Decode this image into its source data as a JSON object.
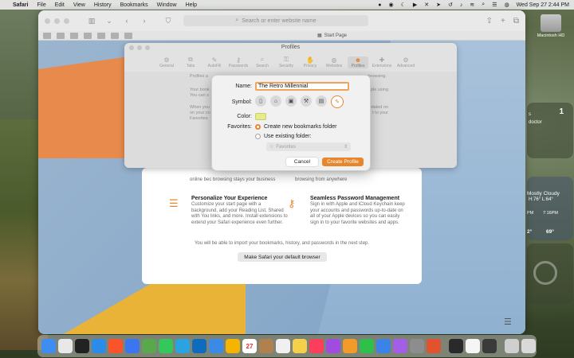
{
  "menubar": {
    "app": "Safari",
    "menus": [
      "File",
      "Edit",
      "View",
      "History",
      "Bookmarks",
      "Window",
      "Help"
    ],
    "clock": "Wed Sep 27  2:44 PM"
  },
  "safari": {
    "address_placeholder": "Search or enter website name",
    "tab_title": "Start Page"
  },
  "profiles_window": {
    "title": "Profiles",
    "tabs": [
      "General",
      "Tabs",
      "AutoFill",
      "Passwords",
      "Search",
      "Security",
      "Privacy",
      "Websites",
      "Profiles",
      "Extensions",
      "Advanced"
    ],
    "left_lines": [
      "Profiles a",
      "Your book",
      "You can s",
      "When you",
      "on your co",
      "Favorites"
    ],
    "right_lines": [
      "browsing.",
      "",
      "pple using",
      "",
      "pdated on",
      "t to your",
      "c"
    ]
  },
  "dialog": {
    "name_label": "Name:",
    "name_value": "The Retro Millennial",
    "symbol_label": "Symbol:",
    "symbols": [
      "id-card-icon",
      "graduation-cap-icon",
      "briefcase-icon",
      "hammer-icon",
      "building-icon",
      "pencil-icon"
    ],
    "color_label": "Color:",
    "color_value": "#e6ec8a",
    "favorites_label": "Favorites:",
    "option_new": "Create new bookmarks folder",
    "option_existing": "Use existing folder:",
    "folder_placeholder": "Favorites",
    "cancel": "Cancel",
    "create": "Create Profile"
  },
  "welcome": {
    "top_left": "online bec  browsing stays your business",
    "top_right": "browsing from anywhere",
    "features": [
      {
        "title": "Personalize Your Experience",
        "body": "Customize your start page with a background, add your Reading List, Shared with You links, and more. Install extensions to extend your Safari experience even further."
      },
      {
        "title": "Seamless Password Management",
        "body": "Sign in with Apple and iCloud Keychain keep your accounts and passwords up-to-date on all of your Apple devices so you can easily sign in to your favorite websites and apps."
      }
    ],
    "import_note": "You will be able to import your bookmarks, history, and passwords in the next step.",
    "default_button": "Make Safari your default browser"
  },
  "desktop": {
    "hdd_label": "Macintosh HD",
    "reminders": {
      "count": "1",
      "text": "s\ndoctor"
    },
    "weather": {
      "condition": "Mostly Cloudy",
      "hilo": "H:76° L:64°",
      "time1": "PM",
      "time2": "7:16PM",
      "temp1": "2°",
      "temp2": "69°"
    }
  },
  "dock_icons": [
    {
      "name": "finder-icon",
      "color": "#3d8ef0"
    },
    {
      "name": "launchpad-icon",
      "color": "#e8e8e8"
    },
    {
      "name": "terminal-icon",
      "color": "#222222"
    },
    {
      "name": "safari-icon",
      "color": "#2a8be8"
    },
    {
      "name": "brave-icon",
      "color": "#fb542b"
    },
    {
      "name": "signal-icon",
      "color": "#3a76f0"
    },
    {
      "name": "maps-icon",
      "color": "#59a84b"
    },
    {
      "name": "messages-icon",
      "color": "#34c759"
    },
    {
      "name": "telegram-icon",
      "color": "#2aa3e0"
    },
    {
      "name": "outlook-icon",
      "color": "#0f6cbd"
    },
    {
      "name": "mail-icon",
      "color": "#3b8be6"
    },
    {
      "name": "photos-icon",
      "color": "#f4b400"
    },
    {
      "name": "calendar-icon",
      "color": "#ffffff"
    },
    {
      "name": "contacts-icon",
      "color": "#b0814f"
    },
    {
      "name": "reminders-icon",
      "color": "#f0f0f0"
    },
    {
      "name": "notes-icon",
      "color": "#f5d04a"
    },
    {
      "name": "music-icon",
      "color": "#fa3e5c"
    },
    {
      "name": "podcasts-icon",
      "color": "#a24be0"
    },
    {
      "name": "pages-icon",
      "color": "#f29b2a"
    },
    {
      "name": "numbers-icon",
      "color": "#2fbf4b"
    },
    {
      "name": "keynote-icon",
      "color": "#3b83e6"
    },
    {
      "name": "flower-app-icon",
      "color": "#a35ee8"
    },
    {
      "name": "settings-icon",
      "color": "#8d8d8d"
    },
    {
      "name": "gauge-icon",
      "color": "#e2522f"
    },
    {
      "name": "activity-monitor-icon",
      "color": "#2a2a2a"
    },
    {
      "name": "clock-icon",
      "color": "#f5f5f5"
    },
    {
      "name": "calculator-icon",
      "color": "#3a3a3a"
    },
    {
      "name": "downloads-icon",
      "color": "#cfcfcf"
    },
    {
      "name": "trash-icon",
      "color": "#d9d9d9"
    }
  ],
  "dock_calendar_day": "27"
}
